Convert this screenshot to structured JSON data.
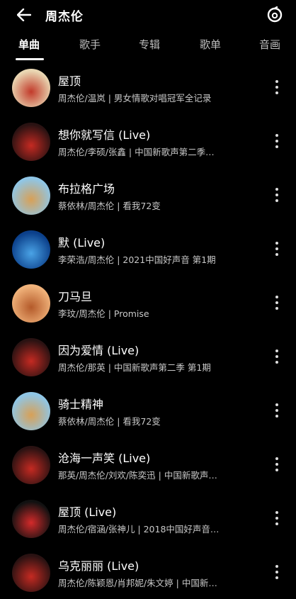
{
  "header": {
    "title": "周杰伦"
  },
  "tabs": [
    {
      "label": "单曲"
    },
    {
      "label": "歌手"
    },
    {
      "label": "专辑"
    },
    {
      "label": "歌单"
    },
    {
      "label": "音画"
    }
  ],
  "songs": [
    {
      "title": "屋顶",
      "artists": "周杰伦/温岚",
      "album": "男女情歌对唱冠军全记录",
      "cover_colors": [
        "#e9d7b3",
        "#c23a2a"
      ]
    },
    {
      "title": "想你就写信 (Live)",
      "artists": "周杰伦/李硕/张鑫",
      "album": "中国新歌声第二季…",
      "cover_colors": [
        "#2a1212",
        "#c52a22"
      ]
    },
    {
      "title": "布拉格广场",
      "artists": "蔡依林/周杰伦",
      "album": "看我72变",
      "cover_colors": [
        "#8fc6e6",
        "#d8a056"
      ]
    },
    {
      "title": "默 (Live)",
      "artists": "李荣浩/周杰伦",
      "album": "2021中国好声音 第1期",
      "cover_colors": [
        "#0b3f8a",
        "#4aa3e6"
      ]
    },
    {
      "title": "刀马旦",
      "artists": "李玟/周杰伦",
      "album": "Promise",
      "cover_colors": [
        "#f0b27a",
        "#b45a2a"
      ]
    },
    {
      "title": "因为爱情 (Live)",
      "artists": "周杰伦/那英",
      "album": "中国新歌声第二季 第1期",
      "cover_colors": [
        "#2a1212",
        "#c52a22"
      ]
    },
    {
      "title": "骑士精神",
      "artists": "蔡依林/周杰伦",
      "album": "看我72变",
      "cover_colors": [
        "#8fc6e6",
        "#d8a056"
      ]
    },
    {
      "title": "沧海一声笑 (Live)",
      "artists": "那英/周杰伦/刘欢/陈奕迅",
      "album": "中国新歌声…",
      "cover_colors": [
        "#2a1212",
        "#c52a22"
      ]
    },
    {
      "title": "屋顶 (Live)",
      "artists": "周杰伦/宿涵/张神儿",
      "album": "2018中国好声音…",
      "cover_colors": [
        "#111111",
        "#d42a2a"
      ]
    },
    {
      "title": "乌克丽丽 (Live)",
      "artists": "周杰伦/陈颖恩/肖邦妮/朱文婷",
      "album": "中国新…",
      "cover_colors": [
        "#2a1212",
        "#c52a22"
      ]
    }
  ]
}
